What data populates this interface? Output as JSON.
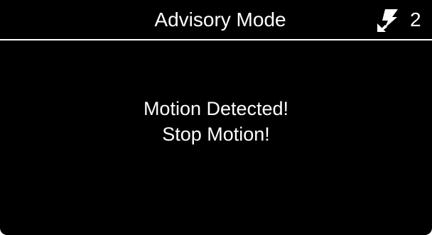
{
  "header": {
    "title": "Advisory Mode",
    "icon": "power-plug-icon",
    "count": "2"
  },
  "message": {
    "line1": "Motion Detected!",
    "line2": "Stop Motion!"
  },
  "colors": {
    "background": "#000000",
    "text": "#ffffff",
    "divider": "#ffffff"
  }
}
